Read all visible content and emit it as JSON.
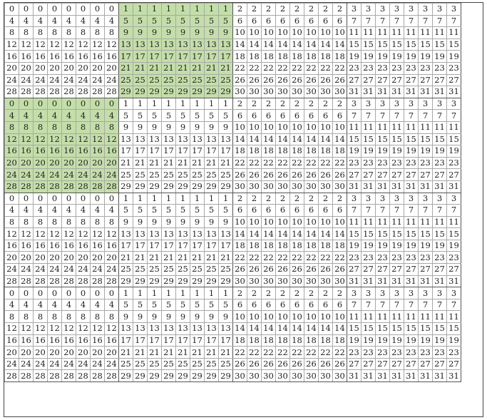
{
  "sheet": {
    "highlight_color": "#c4dea9",
    "grid_color": "#a8a8a8",
    "cell_values": [
      [
        "0",
        "0",
        "0",
        "0",
        "0",
        "0",
        "0",
        "0",
        "1",
        "1",
        "1",
        "1",
        "1",
        "1",
        "1",
        "1",
        "2",
        "2",
        "2",
        "2",
        "2",
        "2",
        "2",
        "2",
        "3",
        "3",
        "3",
        "3",
        "3",
        "3",
        "3",
        "3"
      ],
      [
        "4",
        "4",
        "4",
        "4",
        "4",
        "4",
        "4",
        "4",
        "5",
        "5",
        "5",
        "5",
        "5",
        "5",
        "5",
        "5",
        "6",
        "6",
        "6",
        "6",
        "6",
        "6",
        "6",
        "6",
        "7",
        "7",
        "7",
        "7",
        "7",
        "7",
        "7",
        "7"
      ],
      [
        "8",
        "8",
        "8",
        "8",
        "8",
        "8",
        "8",
        "8",
        "9",
        "9",
        "9",
        "9",
        "9",
        "9",
        "9",
        "9",
        "10",
        "10",
        "10",
        "10",
        "10",
        "10",
        "10",
        "10",
        "11",
        "11",
        "11",
        "11",
        "11",
        "11",
        "11",
        "11"
      ],
      [
        "12",
        "12",
        "12",
        "12",
        "12",
        "12",
        "12",
        "12",
        "13",
        "13",
        "13",
        "13",
        "13",
        "13",
        "13",
        "13",
        "14",
        "14",
        "14",
        "14",
        "14",
        "14",
        "14",
        "14",
        "15",
        "15",
        "15",
        "15",
        "15",
        "15",
        "15",
        "15"
      ],
      [
        "16",
        "16",
        "16",
        "16",
        "16",
        "16",
        "16",
        "16",
        "17",
        "17",
        "17",
        "17",
        "17",
        "17",
        "17",
        "17",
        "18",
        "18",
        "18",
        "18",
        "18",
        "18",
        "18",
        "18",
        "19",
        "19",
        "19",
        "19",
        "19",
        "19",
        "19",
        "19"
      ],
      [
        "20",
        "20",
        "20",
        "20",
        "20",
        "20",
        "20",
        "20",
        "21",
        "21",
        "21",
        "21",
        "21",
        "21",
        "21",
        "21",
        "22",
        "22",
        "22",
        "22",
        "22",
        "22",
        "22",
        "22",
        "23",
        "23",
        "23",
        "23",
        "23",
        "23",
        "23",
        "23"
      ],
      [
        "24",
        "24",
        "24",
        "24",
        "24",
        "24",
        "24",
        "24",
        "25",
        "25",
        "25",
        "25",
        "25",
        "25",
        "25",
        "25",
        "26",
        "26",
        "26",
        "26",
        "26",
        "26",
        "26",
        "26",
        "27",
        "27",
        "27",
        "27",
        "27",
        "27",
        "27",
        "27"
      ],
      [
        "28",
        "28",
        "28",
        "28",
        "28",
        "28",
        "28",
        "28",
        "29",
        "29",
        "29",
        "29",
        "29",
        "29",
        "29",
        "29",
        "30",
        "30",
        "30",
        "30",
        "30",
        "30",
        "30",
        "30",
        "31",
        "31",
        "31",
        "31",
        "31",
        "31",
        "31",
        "31"
      ]
    ],
    "block_rows": 4,
    "highlight_blocks": [
      {
        "row_block": 0,
        "col_start": 8,
        "col_end": 16
      },
      {
        "row_block": 1,
        "col_start": 0,
        "col_end": 8
      }
    ]
  }
}
